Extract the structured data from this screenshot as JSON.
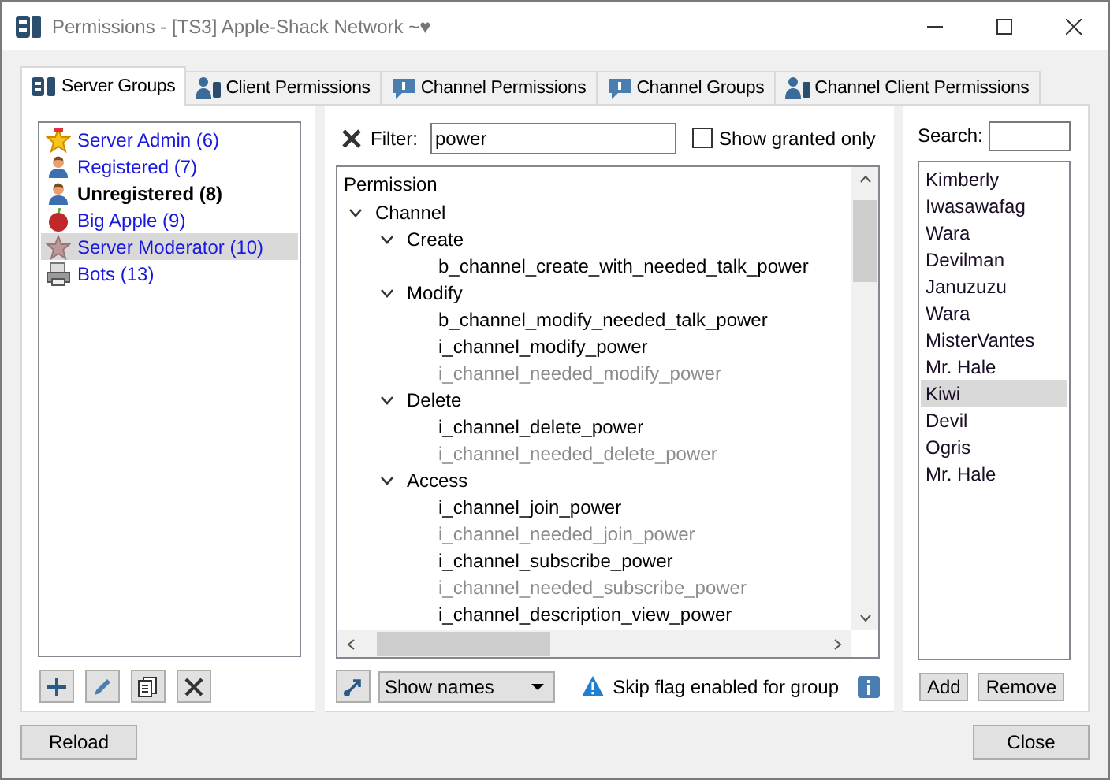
{
  "window": {
    "title": "Permissions - [TS3] Apple-Shack Network ~♥"
  },
  "tabs": [
    {
      "label": "Server Groups",
      "kind": "server",
      "selected": true
    },
    {
      "label": "Client Permissions",
      "kind": "client",
      "selected": false
    },
    {
      "label": "Channel Permissions",
      "kind": "channel",
      "selected": false
    },
    {
      "label": "Channel Groups",
      "kind": "channel",
      "selected": false
    },
    {
      "label": "Channel Client Permissions",
      "kind": "client",
      "selected": false
    }
  ],
  "groups": [
    {
      "name": "Server Admin (6)",
      "kind": "star",
      "default": false,
      "selected": false
    },
    {
      "name": "Registered (7)",
      "kind": "user",
      "default": false,
      "selected": false
    },
    {
      "name": "Unregistered (8)",
      "kind": "user",
      "default": true,
      "selected": false
    },
    {
      "name": "Big Apple (9)",
      "kind": "apple",
      "default": false,
      "selected": false
    },
    {
      "name": "Server Moderator (10)",
      "kind": "faded-star",
      "default": false,
      "selected": true
    },
    {
      "name": "Bots (13)",
      "kind": "printer",
      "default": false,
      "selected": false
    }
  ],
  "filter": {
    "label": "Filter:",
    "value": "power"
  },
  "show_granted": {
    "label": "Show granted only",
    "checked": false
  },
  "tree": {
    "header": "Permission",
    "items": [
      {
        "label": "Channel",
        "expanded": true,
        "children": [
          {
            "label": "Create",
            "expanded": true,
            "children": [
              {
                "label": "b_channel_create_with_needed_talk_power",
                "granted": true
              }
            ]
          },
          {
            "label": "Modify",
            "expanded": true,
            "children": [
              {
                "label": "b_channel_modify_needed_talk_power",
                "granted": true
              },
              {
                "label": "i_channel_modify_power",
                "granted": true
              },
              {
                "label": "i_channel_needed_modify_power",
                "granted": false
              }
            ]
          },
          {
            "label": "Delete",
            "expanded": true,
            "children": [
              {
                "label": "i_channel_delete_power",
                "granted": true
              },
              {
                "label": "i_channel_needed_delete_power",
                "granted": false
              }
            ]
          },
          {
            "label": "Access",
            "expanded": true,
            "children": [
              {
                "label": "i_channel_join_power",
                "granted": true
              },
              {
                "label": "i_channel_needed_join_power",
                "granted": false
              },
              {
                "label": "i_channel_subscribe_power",
                "granted": true
              },
              {
                "label": "i_channel_needed_subscribe_power",
                "granted": false
              },
              {
                "label": "i_channel_description_view_power",
                "granted": true
              }
            ]
          }
        ]
      }
    ]
  },
  "display_mode": {
    "value": "Show names"
  },
  "notice": "Skip flag enabled for group",
  "search": {
    "label": "Search:"
  },
  "clients": [
    {
      "name": "Kimberly",
      "selected": false
    },
    {
      "name": "Iwasawafag",
      "selected": false
    },
    {
      "name": "Wara",
      "selected": false
    },
    {
      "name": "Devilman",
      "selected": false
    },
    {
      "name": "Januzuzu",
      "selected": false
    },
    {
      "name": "Wara",
      "selected": false
    },
    {
      "name": "MisterVantes",
      "selected": false
    },
    {
      "name": "Mr. Hale",
      "selected": false
    },
    {
      "name": "Kiwi",
      "selected": true
    },
    {
      "name": "Devil",
      "selected": false
    },
    {
      "name": "Ogris",
      "selected": false
    },
    {
      "name": "Mr. Hale",
      "selected": false
    }
  ],
  "client_buttons": [
    "Add",
    "Remove"
  ],
  "footer_buttons": [
    "Reload",
    "Close"
  ]
}
